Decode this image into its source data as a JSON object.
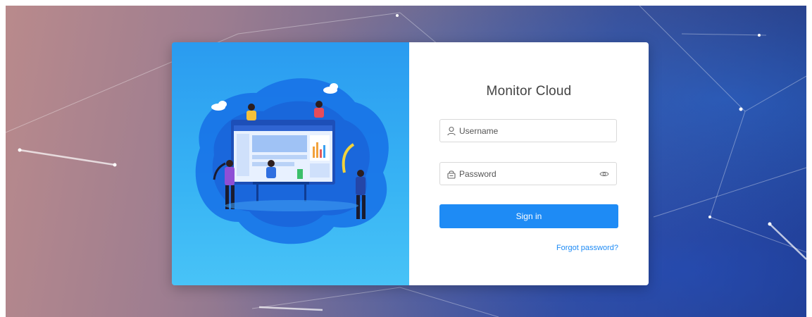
{
  "app": {
    "title": "Monitor Cloud"
  },
  "login": {
    "username_placeholder": "Username",
    "password_placeholder": "Password",
    "signin_label": "Sign in",
    "forgot_label": "Forgot password?"
  },
  "icons": {
    "username": "user-icon",
    "password": "lock-icon",
    "toggle": "eye-icon"
  },
  "colors": {
    "accent": "#1e8bf5",
    "illustration_bg": "#2a9bf0"
  }
}
